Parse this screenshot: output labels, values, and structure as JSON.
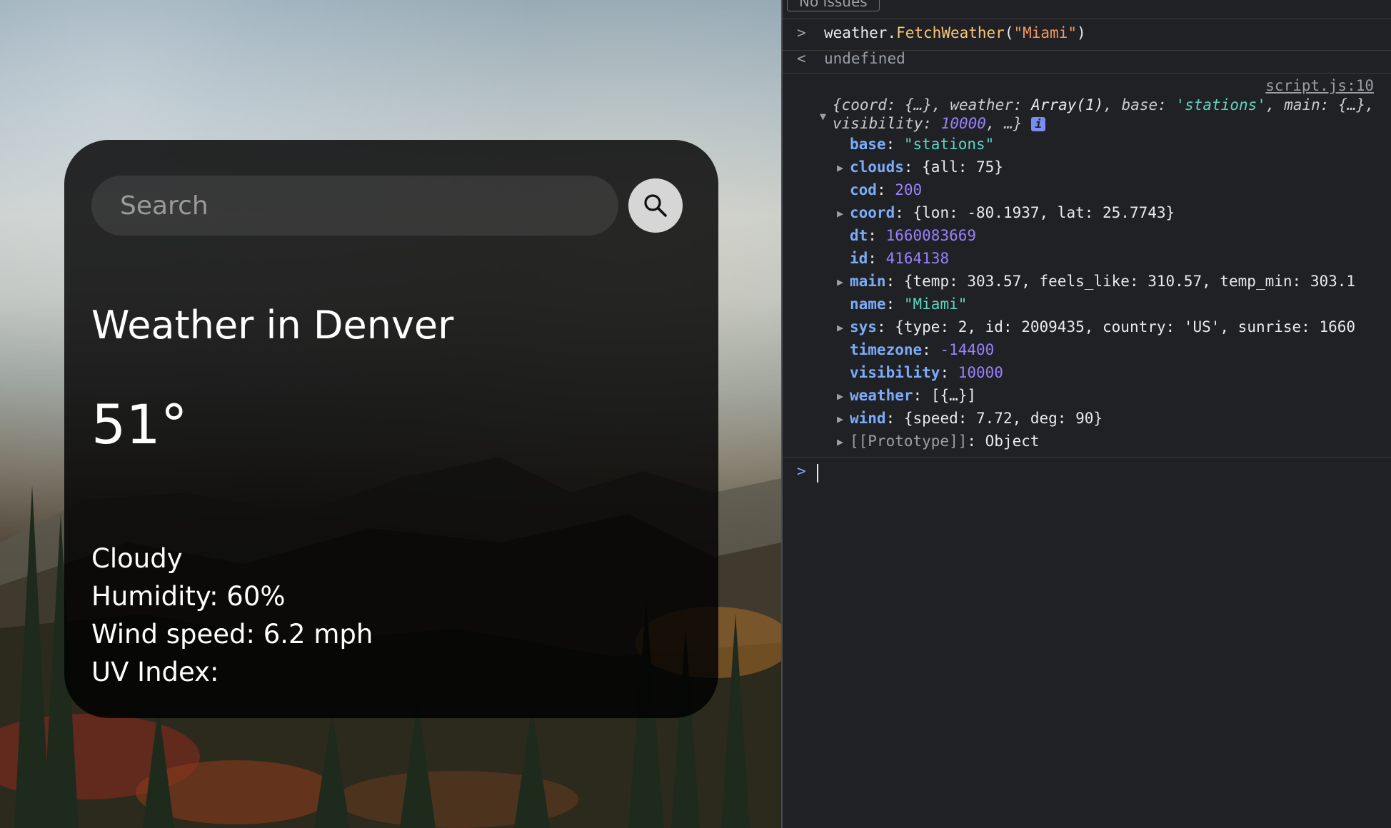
{
  "weather_app": {
    "search": {
      "placeholder": "Search"
    },
    "city_title": "Weather in Denver",
    "temperature": "51°",
    "description": "Cloudy",
    "humidity": "Humidity: 60%",
    "wind": "Wind speed: 6.2 mph",
    "uv": "UV Index:"
  },
  "devtools": {
    "issues_label": "No Issues",
    "input_prompt": ">",
    "command": {
      "object": "weather.",
      "method": "FetchWeather",
      "open": "(",
      "arg": "\"Miami\"",
      "close": ")"
    },
    "result_arrow": "<",
    "result": "undefined",
    "source_link": "script.js:10",
    "summary": {
      "part1": "{coord: {…}, weather: ",
      "array": "Array(1)",
      "part2": ", base: ",
      "base": "'stations'",
      "part3": ", main: {…}, visibility: ",
      "visibility": "10000",
      "part4": ", …}",
      "info": "i"
    },
    "properties": [
      {
        "key": "base",
        "value": "\"stations\"",
        "kind": "string",
        "expandable": false
      },
      {
        "key": "clouds",
        "value": "{all: 75}",
        "kind": "object",
        "expandable": true
      },
      {
        "key": "cod",
        "value": "200",
        "kind": "number",
        "expandable": false
      },
      {
        "key": "coord",
        "value": "{lon: -80.1937, lat: 25.7743}",
        "kind": "object",
        "expandable": true
      },
      {
        "key": "dt",
        "value": "1660083669",
        "kind": "number",
        "expandable": false
      },
      {
        "key": "id",
        "value": "4164138",
        "kind": "number",
        "expandable": false
      },
      {
        "key": "main",
        "value": "{temp: 303.57, feels_like: 310.57, temp_min: 303.1",
        "kind": "object",
        "expandable": true
      },
      {
        "key": "name",
        "value": "\"Miami\"",
        "kind": "string",
        "expandable": false
      },
      {
        "key": "sys",
        "value": "{type: 2, id: 2009435, country: 'US', sunrise: 1660",
        "kind": "object",
        "expandable": true
      },
      {
        "key": "timezone",
        "value": "-14400",
        "kind": "number",
        "expandable": false
      },
      {
        "key": "visibility",
        "value": "10000",
        "kind": "number",
        "expandable": false
      },
      {
        "key": "weather",
        "value": "[{…}]",
        "kind": "object",
        "expandable": true
      },
      {
        "key": "wind",
        "value": "{speed: 7.72, deg: 90}",
        "kind": "object",
        "expandable": true
      },
      {
        "key": "[[Prototype]]",
        "value": "Object",
        "kind": "proto",
        "expandable": true
      }
    ]
  }
}
